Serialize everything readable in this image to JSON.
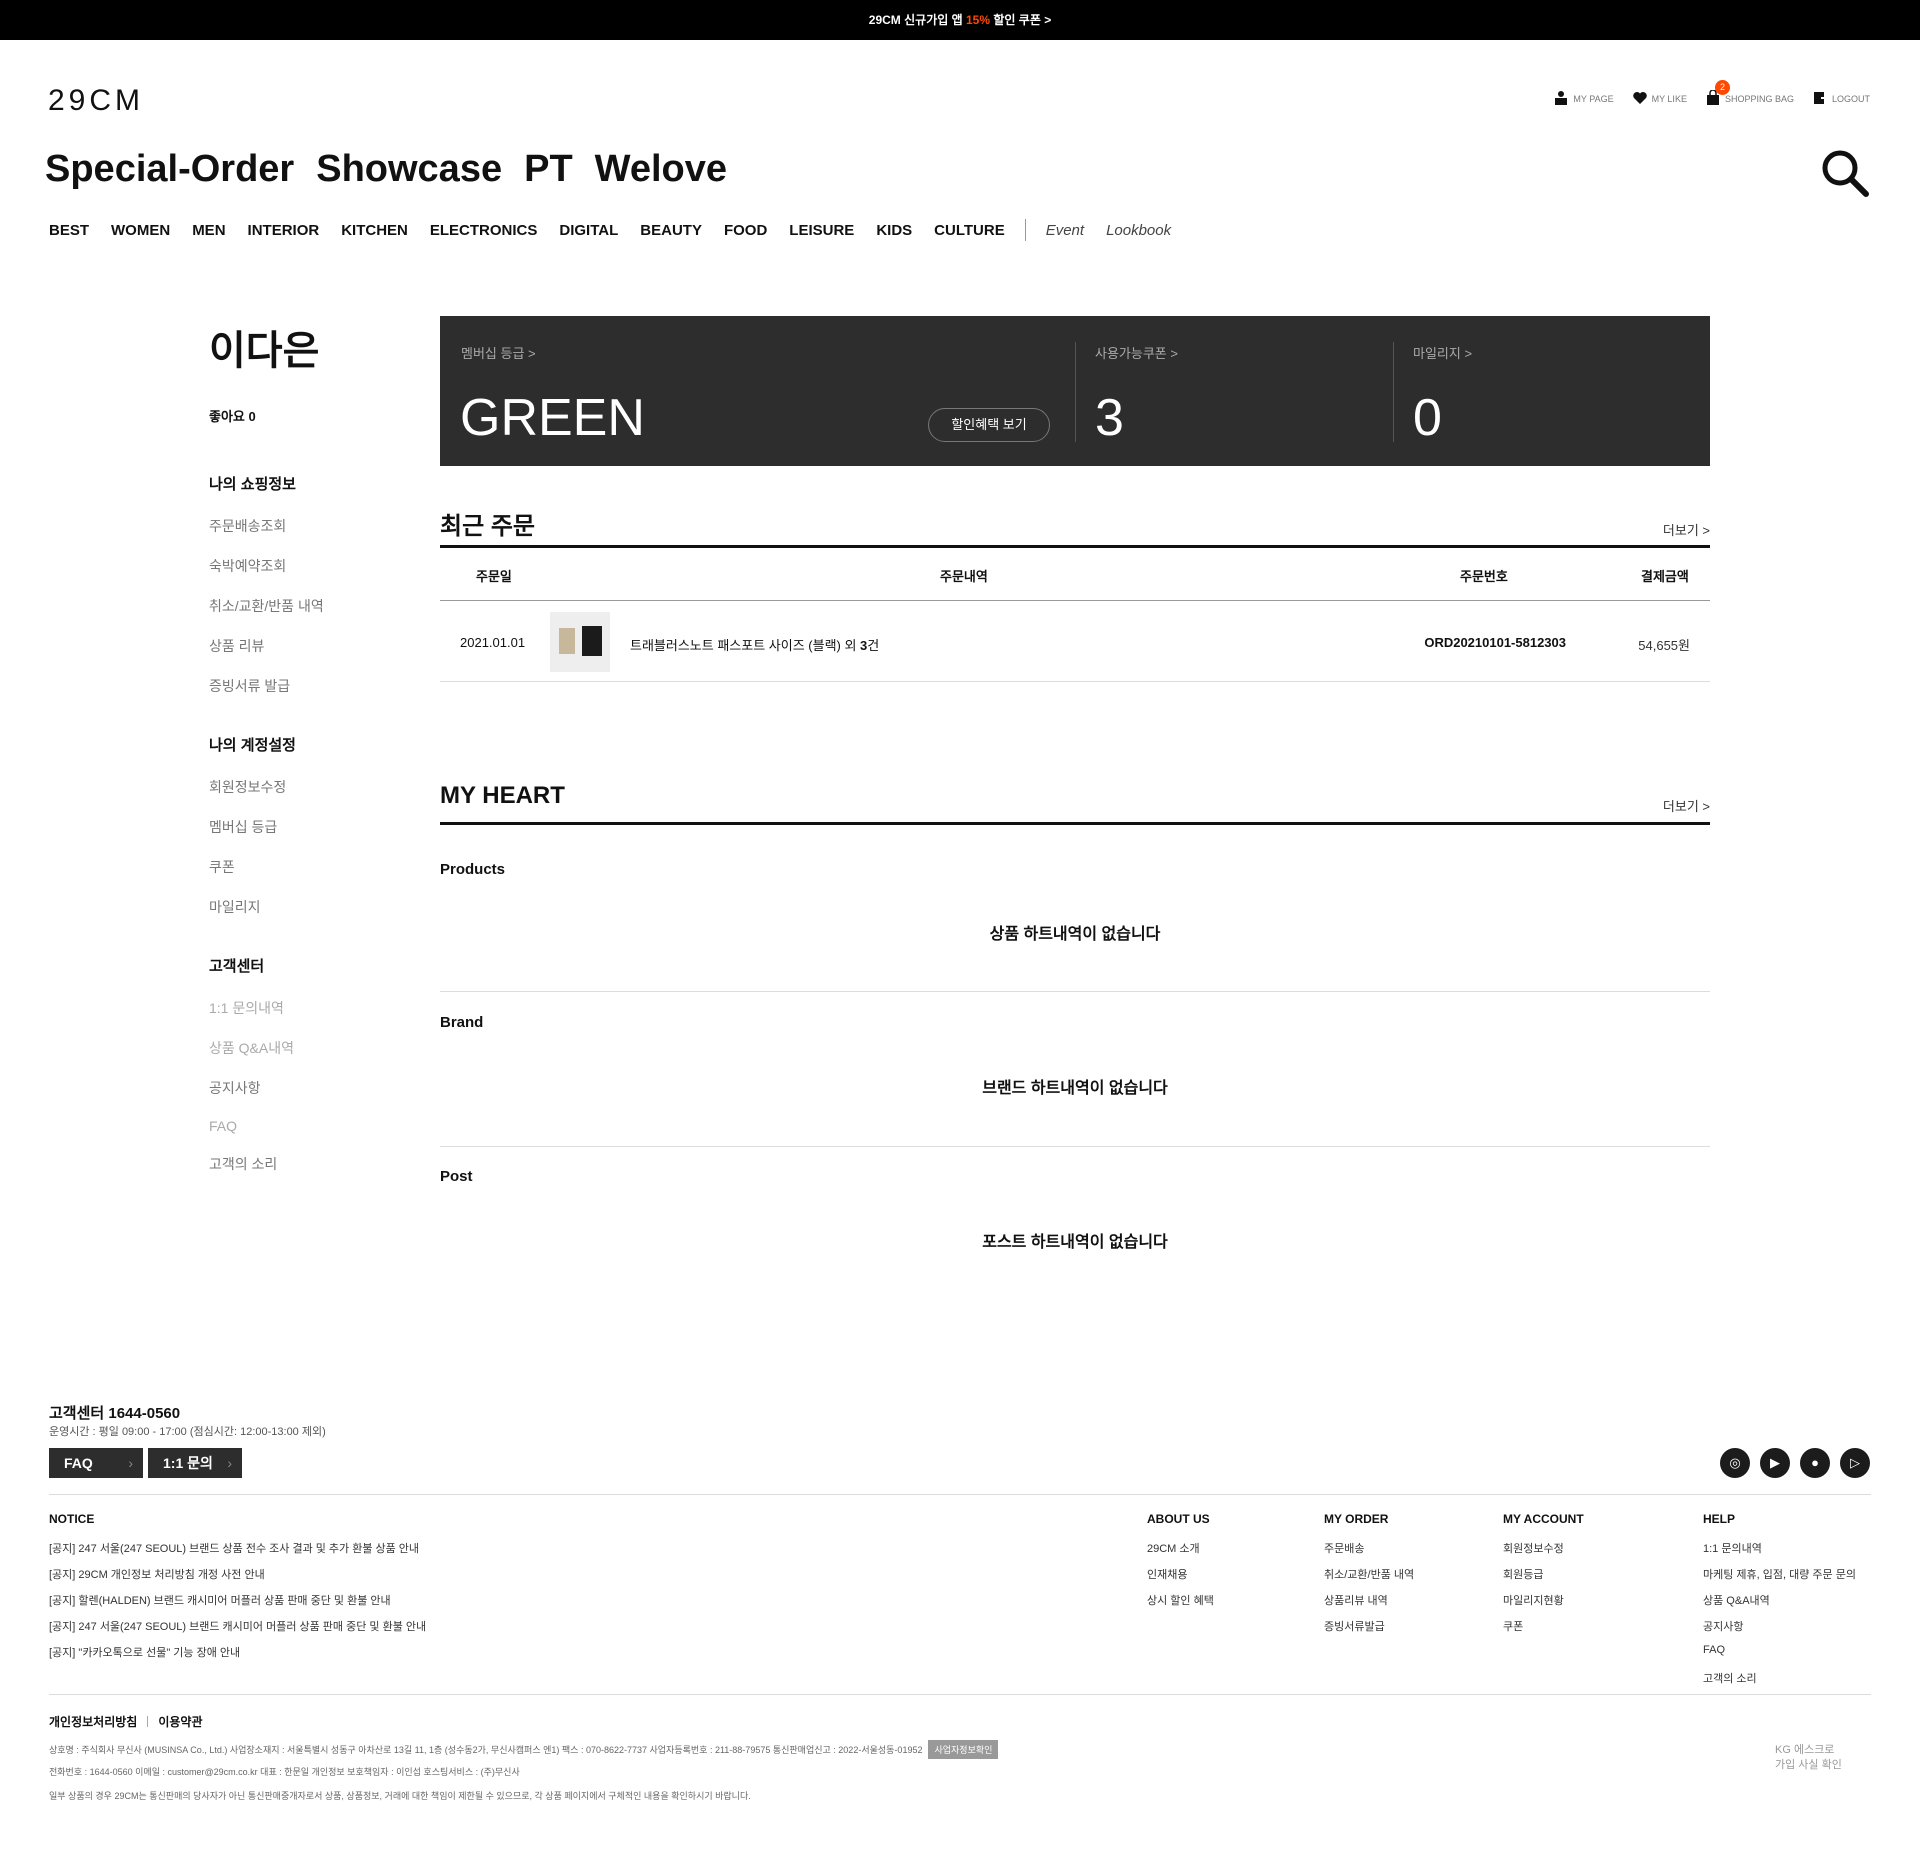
{
  "topbar": {
    "prefix": "29CM 신규가입 앱 ",
    "percent": "15%",
    "suffix": " 할인 쿠폰 >"
  },
  "header": {
    "logo": "29CM",
    "util": {
      "my_page": "MY PAGE",
      "my_like": "MY LIKE",
      "shopping_bag": "SHOPPING BAG",
      "bag_count": "2",
      "logout": "LOGOUT"
    },
    "special_nav": [
      "Special-Order",
      "Showcase",
      "PT",
      "Welove"
    ],
    "main_nav": [
      "BEST",
      "WOMEN",
      "MEN",
      "INTERIOR",
      "KITCHEN",
      "ELECTRONICS",
      "DIGITAL",
      "BEAUTY",
      "FOOD",
      "LEISURE",
      "KIDS",
      "CULTURE"
    ],
    "extra_nav": [
      "Event",
      "Lookbook"
    ]
  },
  "sidebar": {
    "user_name": "이다은",
    "likes_label": "좋아요",
    "likes_count": "0",
    "sections": [
      {
        "title": "나의 쇼핑정보",
        "items": [
          "주문배송조회",
          "숙박예약조회",
          "취소/교환/반품 내역",
          "상품 리뷰",
          "증빙서류 발급"
        ]
      },
      {
        "title": "나의 계정설정",
        "items": [
          "회원정보수정",
          "멤버십 등급",
          "쿠폰",
          "마일리지"
        ]
      },
      {
        "title": "고객센터",
        "items": [
          "1:1 문의내역",
          "상품 Q&A내역",
          "공지사항",
          "FAQ",
          "고객의 소리"
        ]
      }
    ]
  },
  "membership": {
    "grade_label": "멤버십 등급 >",
    "grade_value": "GREEN",
    "benefit_button": "할인혜택 보기",
    "coupon_label": "사용가능쿠폰 >",
    "coupon_value": "3",
    "mileage_label": "마일리지 >",
    "mileage_value": "0"
  },
  "orders": {
    "title": "최근 주문",
    "more": "더보기 >",
    "headers": {
      "date": "주문일",
      "detail": "주문내역",
      "number": "주문번호",
      "amount": "결제금액"
    },
    "rows": [
      {
        "date": "2021.01.01",
        "desc": "트래블러스노트 패스포트 사이즈 (블랙) 외 ",
        "count": "3",
        "count_suffix": "건",
        "number": "ORD20210101-5812303",
        "amount": "54,655원"
      }
    ]
  },
  "heart": {
    "title": "MY HEART",
    "more": "더보기 >",
    "products_label": "Products",
    "products_empty": "상품 하트내역이 없습니다",
    "brand_label": "Brand",
    "brand_empty": "브랜드 하트내역이 없습니다",
    "post_label": "Post",
    "post_empty": "포스트 하트내역이 없습니다"
  },
  "footer": {
    "cs_title": "고객센터 1644-0560",
    "cs_hours": "운영시간 : 평일 09:00 - 17:00 (점심시간: 12:00-13:00 제외)",
    "faq_btn": "FAQ",
    "inquiry_btn": "1:1 문의",
    "notice_title": "NOTICE",
    "notices": [
      "[공지] 247 서울(247 SEOUL) 브랜드 상품 전수 조사 결과 및 추가 환불 상품 안내",
      "[공지] 29CM 개인정보 처리방침 개정 사전 안내",
      "[공지] 할렌(HALDEN) 브랜드 캐시미어 머플러 상품 판매 중단 및 환불 안내",
      "[공지] 247 서울(247 SEOUL) 브랜드 캐시미어 머플러 상품 판매 중단 및 환불 안내",
      "[공지] \"카카오톡으로 선물\" 기능 장애 안내"
    ],
    "columns": [
      {
        "title": "ABOUT US",
        "items": [
          "29CM 소개",
          "인재채용",
          "상시 할인 혜택"
        ]
      },
      {
        "title": "MY ORDER",
        "items": [
          "주문배송",
          "취소/교환/반품 내역",
          "상품리뷰 내역",
          "증빙서류발급"
        ]
      },
      {
        "title": "MY ACCOUNT",
        "items": [
          "회원정보수정",
          "회원등급",
          "마일리지현황",
          "쿠폰"
        ]
      },
      {
        "title": "HELP",
        "items": [
          "1:1 문의내역",
          "마케팅 제휴, 입점, 대량 주문 문의",
          "상품 Q&A내역",
          "공지사항",
          "FAQ",
          "고객의 소리"
        ]
      }
    ],
    "privacy": "개인정보처리방침",
    "terms": "이용약관",
    "info_line1": "상호명 : 주식회사 무신사 (MUSINSA Co., Ltd.)    사업장소재지 : 서울특별시 성동구 아차산로 13길 11, 1층 (성수동2가, 무신사캠퍼스 엔1)    팩스 : 070-8622-7737    사업자등록번호 : 211-88-79575    통신판매업신고 : 2022-서울성동-01952",
    "biz_btn": "사업자정보확인",
    "info_line2": "전화번호 : 1644-0560    이메일 : customer@29cm.co.kr    대표 : 한문일    개인정보 보호책임자 : 이인섭    호스팅서비스 : (주)무신사",
    "info_line3": "일부 상품의 경우 29CM는 통신판매의 당사자가 아닌 통신판매중개자로서 상품, 상품정보, 거래에 대한 책임이 제한될 수 있으므로, 각 상품 페이지에서 구체적인 내용을 확인하시기 바랍니다.",
    "kg_line1": "KG 에스크로",
    "kg_line2": "가입 사실 확인"
  }
}
